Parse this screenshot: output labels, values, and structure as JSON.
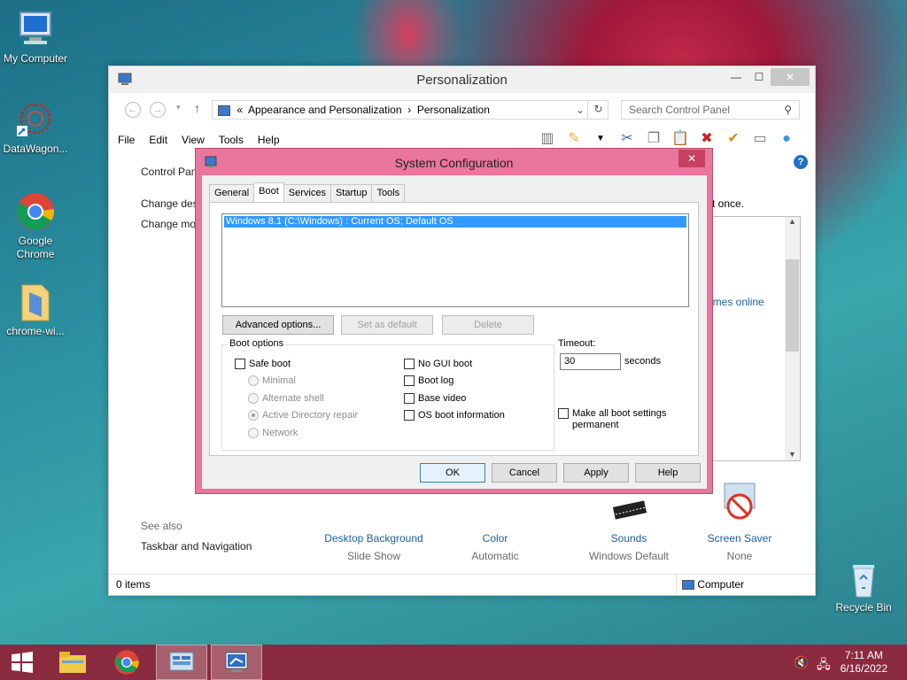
{
  "desktop": {
    "icons": [
      {
        "label": "My Computer",
        "icon": "computer-icon"
      },
      {
        "label": "DataWagon...",
        "icon": "datawagon-icon"
      },
      {
        "label": "Google Chrome",
        "icon": "chrome-icon"
      },
      {
        "label": "chrome-wi...",
        "icon": "folder-icon"
      },
      {
        "label": "Recycle Bin",
        "icon": "recycle-bin-icon"
      }
    ]
  },
  "control_panel": {
    "title": "Personalization",
    "address": {
      "prefix": "«",
      "crumb1": "Appearance and Personalization",
      "sep": "›",
      "crumb2": "Personalization"
    },
    "search_placeholder": "Search Control Panel",
    "menu": [
      "File",
      "Edit",
      "View",
      "Tools",
      "Help"
    ],
    "left": {
      "control_panel_text": "Control Pan",
      "change_des": "Change des",
      "change_mo": "Change mo",
      "see_also": "See also",
      "taskbar_nav": "Taskbar and Navigation"
    },
    "right_text": {
      "at_once": "t once.",
      "themes_online": "emes online"
    },
    "bottom_items": [
      {
        "label": "Desktop Background",
        "sub": "Slide Show"
      },
      {
        "label": "Color",
        "sub": "Automatic"
      },
      {
        "label": "Sounds",
        "sub": "Windows Default"
      },
      {
        "label": "Screen Saver",
        "sub": "None"
      }
    ],
    "status": {
      "items": "0 items",
      "location": "Computer"
    }
  },
  "dialog": {
    "title": "System Configuration",
    "tabs": [
      "General",
      "Boot",
      "Services",
      "Startup",
      "Tools"
    ],
    "active_tab": "Boot",
    "os_entry": "Windows 8.1 (C:\\Windows) : Current OS; Default OS",
    "buttons": {
      "advanced": "Advanced options...",
      "set_default": "Set as default",
      "delete": "Delete",
      "ok": "OK",
      "cancel": "Cancel",
      "apply": "Apply",
      "help": "Help"
    },
    "boot_options": {
      "label": "Boot options",
      "safe_boot": "Safe boot",
      "minimal": "Minimal",
      "alternate_shell": "Alternate shell",
      "ad_repair": "Active Directory repair",
      "network": "Network",
      "no_gui": "No GUI boot",
      "boot_log": "Boot log",
      "base_video": "Base video",
      "os_boot_info": "OS boot information"
    },
    "timeout": {
      "label": "Timeout:",
      "value": "30",
      "unit": "seconds"
    },
    "make_permanent": {
      "line1": "Make all boot settings",
      "line2": "permanent"
    }
  },
  "taskbar": {
    "time": "7:11 AM",
    "date": "6/16/2022"
  }
}
